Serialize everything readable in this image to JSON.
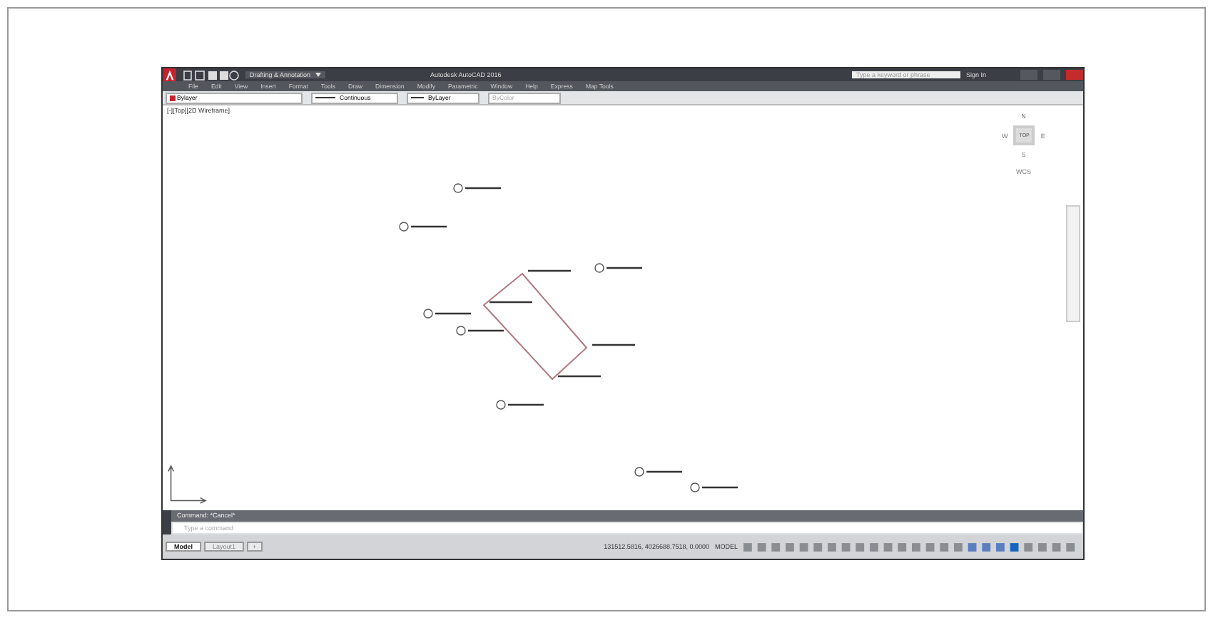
{
  "window": {
    "workspace": "Drafting & Annotation",
    "title": "Autodesk AutoCAD 2016",
    "search": {
      "placeholder": "Type a keyword or phrase"
    },
    "sign_in": "Sign In"
  },
  "menu": [
    "File",
    "Edit",
    "View",
    "Insert",
    "Format",
    "Tools",
    "Draw",
    "Dimension",
    "Modify",
    "Parametric",
    "Window",
    "Help",
    "Express",
    "Map Tools"
  ],
  "properties": {
    "layer": "Bylayer",
    "linetype": "Continuous",
    "lineweight": "ByLayer",
    "plot_style": "ByColor"
  },
  "viewport": {
    "label": "[-][Top][2D Wireframe]"
  },
  "viewcube": {
    "north": "N",
    "west": "W",
    "east": "E",
    "south": "S",
    "face": "TOP",
    "ucs": "WCS"
  },
  "command_line": {
    "history": "Command: *Cancel*",
    "placeholder": "Type a command"
  },
  "layout_tabs": [
    {
      "label": "Model",
      "selected": true
    },
    {
      "label": "Layout1",
      "selected": false
    }
  ],
  "add_layout": "+",
  "status_bar": {
    "coordinates": "131512.5816, 4026688.7518, 0.0000",
    "space": "MODEL"
  }
}
